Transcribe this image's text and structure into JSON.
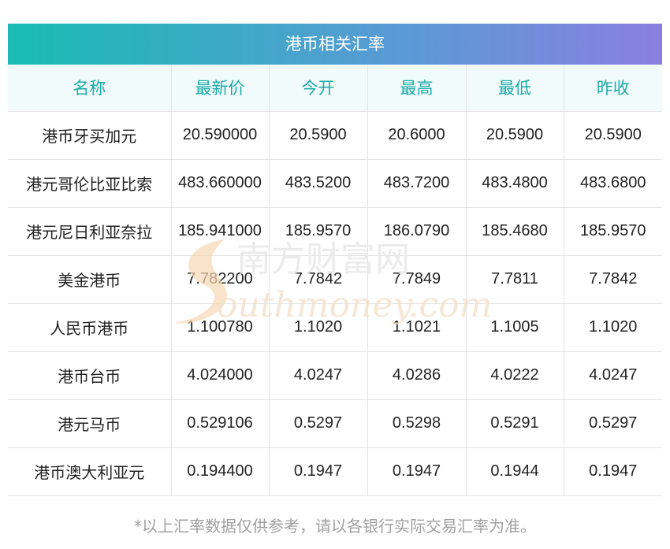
{
  "title": "港币相关汇率",
  "headers": [
    "名称",
    "最新价",
    "今开",
    "最高",
    "最低",
    "昨收"
  ],
  "rows": [
    [
      "港币牙买加元",
      "20.590000",
      "20.5900",
      "20.6000",
      "20.5900",
      "20.5900"
    ],
    [
      "港元哥伦比亚比索",
      "483.660000",
      "483.5200",
      "483.7200",
      "483.4800",
      "483.6800"
    ],
    [
      "港元尼日利亚奈拉",
      "185.941000",
      "185.9570",
      "186.0790",
      "185.4680",
      "185.9570"
    ],
    [
      "美金港币",
      "7.782200",
      "7.7842",
      "7.7849",
      "7.7811",
      "7.7842"
    ],
    [
      "人民币港币",
      "1.100780",
      "1.1020",
      "1.1021",
      "1.1005",
      "1.1020"
    ],
    [
      "港币台币",
      "4.024000",
      "4.0247",
      "4.0286",
      "4.0222",
      "4.0247"
    ],
    [
      "港元马币",
      "0.529106",
      "0.5297",
      "0.5298",
      "0.5291",
      "0.5297"
    ],
    [
      "港币澳大利亚元",
      "0.194400",
      "0.1947",
      "0.1947",
      "0.1944",
      "0.1947"
    ]
  ],
  "watermark": {
    "cn": "南方财富网",
    "en": "outhmoney.com"
  },
  "footnote": "*以上汇率数据仅供参考，请以各银行实际交易汇率为准。",
  "colors": {
    "header_text": "#1aaba7",
    "gradient_start": "#19bcb3",
    "gradient_end": "#8a7fe0"
  }
}
